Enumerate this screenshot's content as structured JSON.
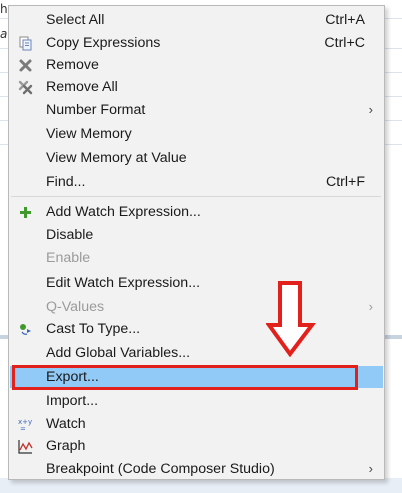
{
  "background": {
    "left_glyphs": [
      "h",
      "a"
    ]
  },
  "menu": {
    "items": [
      {
        "label": "Select All",
        "accel": "Ctrl+A",
        "icon": ""
      },
      {
        "label": "Copy Expressions",
        "accel": "Ctrl+C",
        "icon": "copy-icon"
      },
      {
        "label": "Remove",
        "accel": "",
        "icon": "remove-icon"
      },
      {
        "label": "Remove All",
        "accel": "",
        "icon": "remove-all-icon"
      },
      {
        "label": "Number Format",
        "accel": "",
        "submenu": true
      },
      {
        "label": "View Memory",
        "accel": ""
      },
      {
        "label": "View Memory at Value",
        "accel": ""
      },
      {
        "label": "Find...",
        "accel": "Ctrl+F"
      },
      {
        "label": "Add Watch Expression...",
        "accel": "",
        "icon": "add-icon"
      },
      {
        "label": "Disable",
        "accel": ""
      },
      {
        "label": "Enable",
        "accel": "",
        "disabled": true
      },
      {
        "label": "Edit Watch Expression...",
        "accel": ""
      },
      {
        "label": "Q-Values",
        "accel": "",
        "disabled": true,
        "submenu": true
      },
      {
        "label": "Cast To Type...",
        "accel": "",
        "icon": "cast-icon"
      },
      {
        "label": "Add Global Variables...",
        "accel": ""
      },
      {
        "label": "Export...",
        "accel": "",
        "highlighted": true
      },
      {
        "label": "Import...",
        "accel": ""
      },
      {
        "label": "Watch",
        "accel": "",
        "icon": "watch-xy-icon"
      },
      {
        "label": "Graph",
        "accel": "",
        "icon": "graph-icon"
      },
      {
        "label": "Breakpoint (Code Composer Studio)",
        "accel": "",
        "submenu": true
      }
    ]
  },
  "colors": {
    "highlight": "#91c9f7",
    "annotation": "#e2211c"
  }
}
